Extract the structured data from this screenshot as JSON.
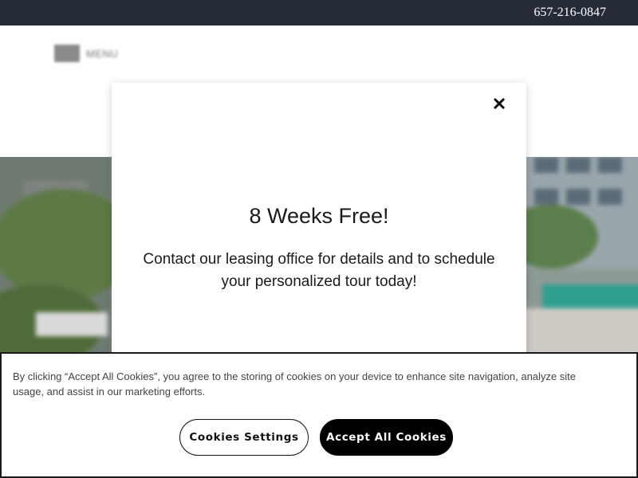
{
  "topbar": {
    "phone": "657-216-0847"
  },
  "header": {
    "menu_label": "MENU"
  },
  "modal": {
    "title": "8 Weeks Free!",
    "body": "Contact our leasing office for details and to schedule your personalized tour today!",
    "close_icon": "close-icon"
  },
  "cookie_banner": {
    "text": "By clicking “Accept All Cookies”, you agree to the storing of cookies on your device to enhance site navigation, analyze site usage, and assist in our marketing efforts.",
    "settings_label": "Cookies Settings",
    "accept_label": "Accept All Cookies"
  },
  "colors": {
    "topbar": "#262b38",
    "accent": "#000000"
  }
}
